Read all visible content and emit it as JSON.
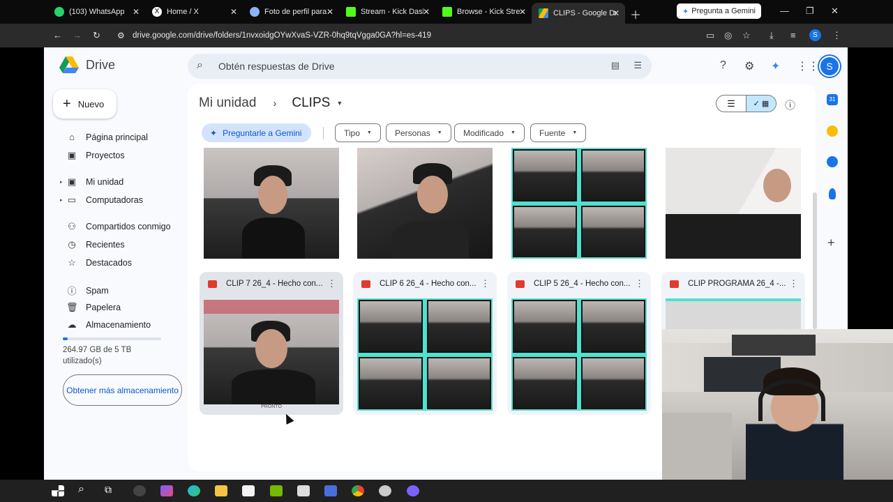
{
  "browser": {
    "tabs": [
      {
        "title": "(103) WhatsApp",
        "color": "#25d366"
      },
      {
        "title": "Home / X",
        "color": "#000000"
      },
      {
        "title": "Foto de perfil para",
        "color": "#8ab4f8"
      },
      {
        "title": "Stream - Kick Dash",
        "color": "#53fc18"
      },
      {
        "title": "Browse - Kick Strea",
        "color": "#53fc18"
      },
      {
        "title": "CLIPS - Google Dri",
        "color": "#fbbc04",
        "active": true
      }
    ],
    "gemini_button": "Pregunta a Gemini",
    "url": "drive.google.com/drive/folders/1nvxoidgOYwXvaS-VZR-0hq9tqVgga0GA?hl=es-419",
    "profile_initial": "S"
  },
  "drive": {
    "app_name": "Drive",
    "search_placeholder": "Obtén respuestas de Drive",
    "avatar_initial": "S",
    "new_button": "Nuevo",
    "nav": [
      {
        "label": "Página principal",
        "icon": "home-icon"
      },
      {
        "label": "Proyectos",
        "icon": "projects-icon"
      },
      {
        "label": "Mi unidad",
        "icon": "my-drive-icon"
      },
      {
        "label": "Computadoras",
        "icon": "computers-icon"
      },
      {
        "label": "Compartidos conmigo",
        "icon": "shared-icon"
      },
      {
        "label": "Recientes",
        "icon": "clock-icon"
      },
      {
        "label": "Destacados",
        "icon": "star-icon"
      },
      {
        "label": "Spam",
        "icon": "spam-icon"
      },
      {
        "label": "Papelera",
        "icon": "trash-icon"
      },
      {
        "label": "Almacenamiento",
        "icon": "cloud-icon"
      }
    ],
    "storage": {
      "text": "264.97 GB de 5 TB utilizado(s)",
      "used_fraction": 0.05,
      "button": "Obtener más almacenamiento"
    },
    "breadcrumb": {
      "root": "Mi unidad",
      "current": "CLIPS"
    },
    "gemini_chip": "Preguntarle a Gemini",
    "filters": [
      "Tipo",
      "Personas",
      "Modificado",
      "Fuente"
    ],
    "files": [
      {
        "name": "CLIP 7 26_4 - Hecho con..."
      },
      {
        "name": "CLIP 6 26_4 - Hecho con..."
      },
      {
        "name": "CLIP 5 26_4 - Hecho con..."
      },
      {
        "name": "CLIP PROGRAMA 26_4 -..."
      }
    ],
    "thumb_caption": "PRONTO"
  },
  "colors": {
    "accent": "#1a73e8",
    "chip_gemini": "#d3e3fd",
    "selected_view": "#c2e7ff"
  }
}
